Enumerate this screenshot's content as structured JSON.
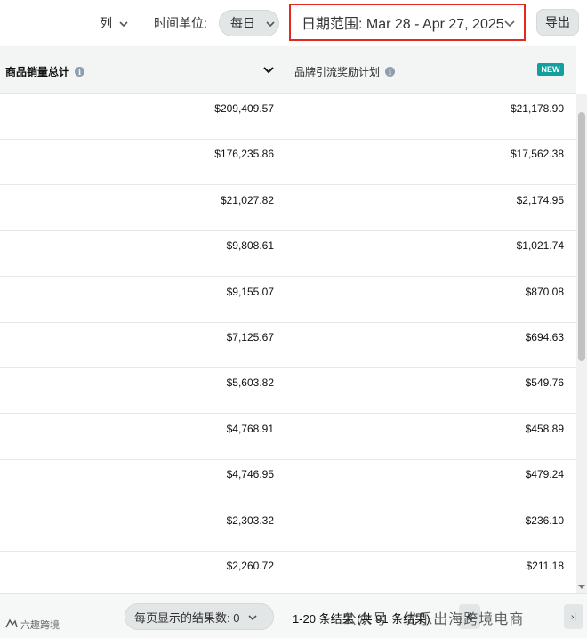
{
  "toolbar": {
    "columns_label": "列",
    "time_unit_label": "时间单位:",
    "time_unit_value": "每日",
    "date_range": "日期范围: Mar 28 - Apr 27, 2025",
    "export_label": "导出",
    "highlight_color": "#e3281f"
  },
  "table": {
    "headers": {
      "col1": "商品销量总计",
      "col2": "品牌引流奖励计划",
      "new_badge": "NEW"
    },
    "rows": [
      {
        "sales": "$209,409.57",
        "bonus": "$21,178.90"
      },
      {
        "sales": "$176,235.86",
        "bonus": "$17,562.38"
      },
      {
        "sales": "$21,027.82",
        "bonus": "$2,174.95"
      },
      {
        "sales": "$9,808.61",
        "bonus": "$1,021.74"
      },
      {
        "sales": "$9,155.07",
        "bonus": "$870.08"
      },
      {
        "sales": "$7,125.67",
        "bonus": "$694.63"
      },
      {
        "sales": "$5,603.82",
        "bonus": "$549.76"
      },
      {
        "sales": "$4,768.91",
        "bonus": "$458.89"
      },
      {
        "sales": "$4,746.95",
        "bonus": "$479.24"
      },
      {
        "sales": "$2,303.32",
        "bonus": "$236.10"
      },
      {
        "sales": "$2,260.72",
        "bonus": "$211.18"
      }
    ]
  },
  "footer": {
    "per_page_label": "每页显示的结果数: 0",
    "range_text": "1-20 条结果 (共 91 条结果)",
    "next_last_glyph": "›|"
  },
  "watermark": {
    "text": "公众号 · 优乐出海跨境电商",
    "left_text": "六趣跨境"
  }
}
